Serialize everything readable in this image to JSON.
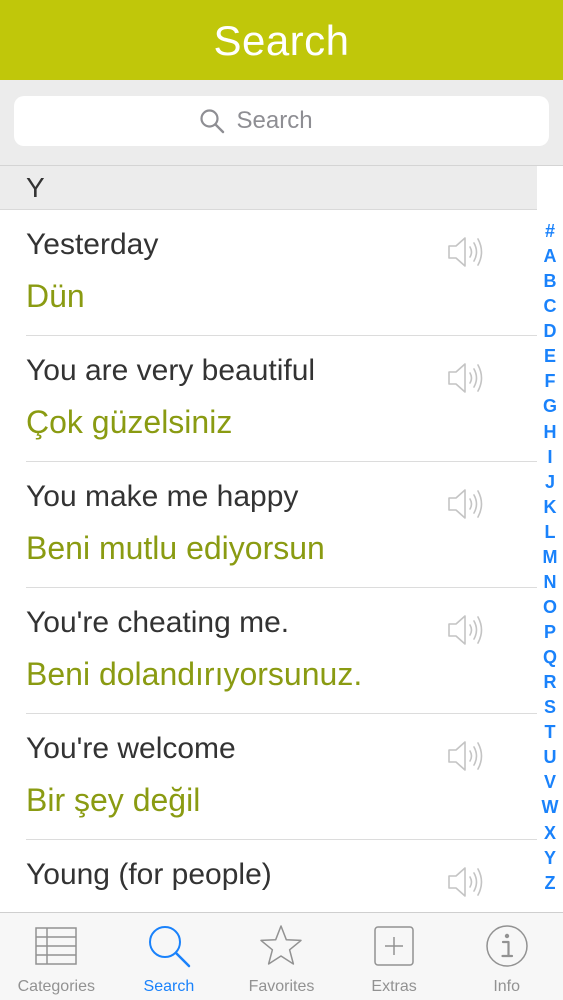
{
  "nav": {
    "title": "Search"
  },
  "search": {
    "placeholder": "Search"
  },
  "section": {
    "letter": "Y"
  },
  "phrases": [
    {
      "english": "Yesterday",
      "translation": "Dün"
    },
    {
      "english": "You are very beautiful",
      "translation": "Çok güzelsiniz"
    },
    {
      "english": "You make me happy",
      "translation": "Beni mutlu ediyorsun"
    },
    {
      "english": "You're cheating me.",
      "translation": "Beni dolandırıyorsunuz."
    },
    {
      "english": "You're welcome",
      "translation": "Bir şey değil"
    },
    {
      "english": "Young (for people)",
      "translation": ""
    }
  ],
  "index_letters": [
    "#",
    "A",
    "B",
    "C",
    "D",
    "E",
    "F",
    "G",
    "H",
    "I",
    "J",
    "K",
    "L",
    "M",
    "N",
    "O",
    "P",
    "Q",
    "R",
    "S",
    "T",
    "U",
    "V",
    "W",
    "X",
    "Y",
    "Z"
  ],
  "tabs": [
    {
      "label": "Categories",
      "icon": "list-icon",
      "active": false
    },
    {
      "label": "Search",
      "icon": "search-icon",
      "active": true
    },
    {
      "label": "Favorites",
      "icon": "star-icon",
      "active": false
    },
    {
      "label": "Extras",
      "icon": "plus-box-icon",
      "active": false
    },
    {
      "label": "Info",
      "icon": "info-icon",
      "active": false
    }
  ],
  "colors": {
    "nav_background": "#c0c70a",
    "translation_text": "#8a9b12",
    "accent_blue": "#1a82fb",
    "inactive_tab": "#929292"
  }
}
